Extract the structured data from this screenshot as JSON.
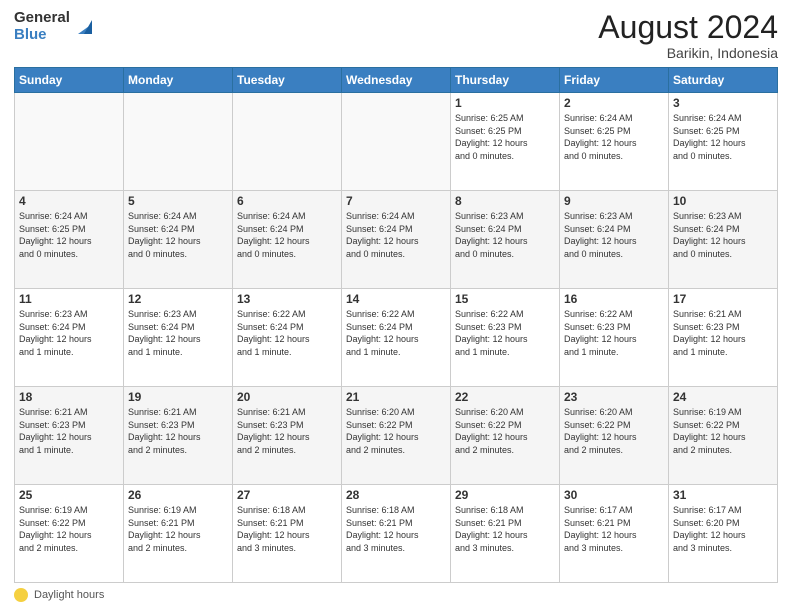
{
  "logo": {
    "general": "General",
    "blue": "Blue"
  },
  "title": "August 2024",
  "location": "Barikin, Indonesia",
  "days_of_week": [
    "Sunday",
    "Monday",
    "Tuesday",
    "Wednesday",
    "Thursday",
    "Friday",
    "Saturday"
  ],
  "footer": {
    "legend_label": "Daylight hours"
  },
  "weeks": [
    [
      {
        "day": "",
        "info": ""
      },
      {
        "day": "",
        "info": ""
      },
      {
        "day": "",
        "info": ""
      },
      {
        "day": "",
        "info": ""
      },
      {
        "day": "1",
        "info": "Sunrise: 6:25 AM\nSunset: 6:25 PM\nDaylight: 12 hours\nand 0 minutes."
      },
      {
        "day": "2",
        "info": "Sunrise: 6:24 AM\nSunset: 6:25 PM\nDaylight: 12 hours\nand 0 minutes."
      },
      {
        "day": "3",
        "info": "Sunrise: 6:24 AM\nSunset: 6:25 PM\nDaylight: 12 hours\nand 0 minutes."
      }
    ],
    [
      {
        "day": "4",
        "info": "Sunrise: 6:24 AM\nSunset: 6:25 PM\nDaylight: 12 hours\nand 0 minutes."
      },
      {
        "day": "5",
        "info": "Sunrise: 6:24 AM\nSunset: 6:24 PM\nDaylight: 12 hours\nand 0 minutes."
      },
      {
        "day": "6",
        "info": "Sunrise: 6:24 AM\nSunset: 6:24 PM\nDaylight: 12 hours\nand 0 minutes."
      },
      {
        "day": "7",
        "info": "Sunrise: 6:24 AM\nSunset: 6:24 PM\nDaylight: 12 hours\nand 0 minutes."
      },
      {
        "day": "8",
        "info": "Sunrise: 6:23 AM\nSunset: 6:24 PM\nDaylight: 12 hours\nand 0 minutes."
      },
      {
        "day": "9",
        "info": "Sunrise: 6:23 AM\nSunset: 6:24 PM\nDaylight: 12 hours\nand 0 minutes."
      },
      {
        "day": "10",
        "info": "Sunrise: 6:23 AM\nSunset: 6:24 PM\nDaylight: 12 hours\nand 0 minutes."
      }
    ],
    [
      {
        "day": "11",
        "info": "Sunrise: 6:23 AM\nSunset: 6:24 PM\nDaylight: 12 hours\nand 1 minute."
      },
      {
        "day": "12",
        "info": "Sunrise: 6:23 AM\nSunset: 6:24 PM\nDaylight: 12 hours\nand 1 minute."
      },
      {
        "day": "13",
        "info": "Sunrise: 6:22 AM\nSunset: 6:24 PM\nDaylight: 12 hours\nand 1 minute."
      },
      {
        "day": "14",
        "info": "Sunrise: 6:22 AM\nSunset: 6:24 PM\nDaylight: 12 hours\nand 1 minute."
      },
      {
        "day": "15",
        "info": "Sunrise: 6:22 AM\nSunset: 6:23 PM\nDaylight: 12 hours\nand 1 minute."
      },
      {
        "day": "16",
        "info": "Sunrise: 6:22 AM\nSunset: 6:23 PM\nDaylight: 12 hours\nand 1 minute."
      },
      {
        "day": "17",
        "info": "Sunrise: 6:21 AM\nSunset: 6:23 PM\nDaylight: 12 hours\nand 1 minute."
      }
    ],
    [
      {
        "day": "18",
        "info": "Sunrise: 6:21 AM\nSunset: 6:23 PM\nDaylight: 12 hours\nand 1 minute."
      },
      {
        "day": "19",
        "info": "Sunrise: 6:21 AM\nSunset: 6:23 PM\nDaylight: 12 hours\nand 2 minutes."
      },
      {
        "day": "20",
        "info": "Sunrise: 6:21 AM\nSunset: 6:23 PM\nDaylight: 12 hours\nand 2 minutes."
      },
      {
        "day": "21",
        "info": "Sunrise: 6:20 AM\nSunset: 6:22 PM\nDaylight: 12 hours\nand 2 minutes."
      },
      {
        "day": "22",
        "info": "Sunrise: 6:20 AM\nSunset: 6:22 PM\nDaylight: 12 hours\nand 2 minutes."
      },
      {
        "day": "23",
        "info": "Sunrise: 6:20 AM\nSunset: 6:22 PM\nDaylight: 12 hours\nand 2 minutes."
      },
      {
        "day": "24",
        "info": "Sunrise: 6:19 AM\nSunset: 6:22 PM\nDaylight: 12 hours\nand 2 minutes."
      }
    ],
    [
      {
        "day": "25",
        "info": "Sunrise: 6:19 AM\nSunset: 6:22 PM\nDaylight: 12 hours\nand 2 minutes."
      },
      {
        "day": "26",
        "info": "Sunrise: 6:19 AM\nSunset: 6:21 PM\nDaylight: 12 hours\nand 2 minutes."
      },
      {
        "day": "27",
        "info": "Sunrise: 6:18 AM\nSunset: 6:21 PM\nDaylight: 12 hours\nand 3 minutes."
      },
      {
        "day": "28",
        "info": "Sunrise: 6:18 AM\nSunset: 6:21 PM\nDaylight: 12 hours\nand 3 minutes."
      },
      {
        "day": "29",
        "info": "Sunrise: 6:18 AM\nSunset: 6:21 PM\nDaylight: 12 hours\nand 3 minutes."
      },
      {
        "day": "30",
        "info": "Sunrise: 6:17 AM\nSunset: 6:21 PM\nDaylight: 12 hours\nand 3 minutes."
      },
      {
        "day": "31",
        "info": "Sunrise: 6:17 AM\nSunset: 6:20 PM\nDaylight: 12 hours\nand 3 minutes."
      }
    ]
  ]
}
